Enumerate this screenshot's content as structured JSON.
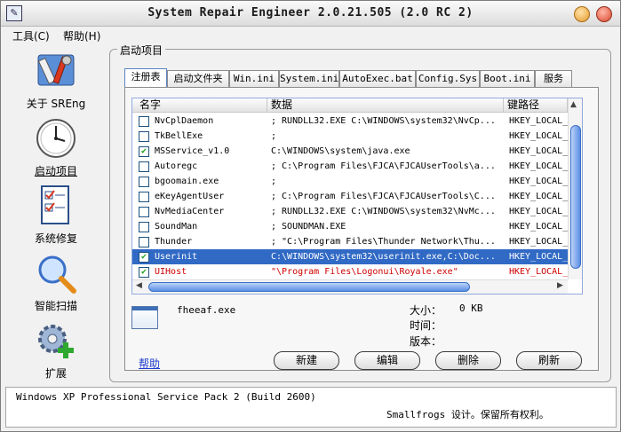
{
  "window": {
    "title": "System Repair Engineer 2.0.21.505 (2.0 RC 2)"
  },
  "menu": [
    "工具(C)",
    "帮助(H)"
  ],
  "nav": [
    {
      "label": "关于 SREng",
      "icon": "tools-icon"
    },
    {
      "label": "启动项目",
      "icon": "clock-icon",
      "selected": true
    },
    {
      "label": "系统修复",
      "icon": "checklist-icon"
    },
    {
      "label": "智能扫描",
      "icon": "magnifier-icon"
    },
    {
      "label": "扩展",
      "icon": "gear-plus-icon"
    }
  ],
  "group_title": "启动项目",
  "tabs": [
    "注册表",
    "启动文件夹",
    "Win.ini",
    "System.ini",
    "AutoExec.bat",
    "Config.Sys",
    "Boot.ini",
    "服务"
  ],
  "list": {
    "headers": [
      "名字",
      "数据",
      "键路径"
    ],
    "rows": [
      {
        "checked": false,
        "name": "NvCplDaemon",
        "data": "; RUNDLL32.EXE C:\\WINDOWS\\system32\\NvCp...",
        "key": "HKEY_LOCAL_M"
      },
      {
        "checked": false,
        "name": "TkBellExe",
        "data": ";",
        "key": "HKEY_LOCAL_M"
      },
      {
        "checked": true,
        "name": "MSService_v1.0",
        "data": "C:\\WINDOWS\\system\\java.exe",
        "key": "HKEY_LOCAL_M"
      },
      {
        "checked": false,
        "name": "Autoregc",
        "data": "; C:\\Program Files\\FJCA\\FJCAUserTools\\a...",
        "key": "HKEY_LOCAL_M"
      },
      {
        "checked": false,
        "name": "bgoomain.exe",
        "data": ";",
        "key": "HKEY_LOCAL_M"
      },
      {
        "checked": false,
        "name": "eKeyAgentUser",
        "data": "; C:\\Program Files\\FJCA\\FJCAUserTools\\C...",
        "key": "HKEY_LOCAL_M"
      },
      {
        "checked": false,
        "name": "NvMediaCenter",
        "data": "; RUNDLL32.EXE C:\\WINDOWS\\system32\\NvMc...",
        "key": "HKEY_LOCAL_M"
      },
      {
        "checked": false,
        "name": "SoundMan",
        "data": "; SOUNDMAN.EXE",
        "key": "HKEY_LOCAL_M"
      },
      {
        "checked": false,
        "name": "Thunder",
        "data": "; \"C:\\Program Files\\Thunder Network\\Thu...",
        "key": "HKEY_LOCAL_M"
      },
      {
        "checked": true,
        "name": "Userinit",
        "data": "C:\\WINDOWS\\system32\\userinit.exe,C:\\Doc...",
        "key": "HKEY_LOCAL_M",
        "selected": true
      },
      {
        "checked": true,
        "name": "UIHost",
        "data": "\"\\Program Files\\Logonui\\Royale.exe\"",
        "key": "HKEY_LOCAL_M",
        "red": true
      }
    ]
  },
  "details": {
    "filename": "fheeaf.exe",
    "size_label": "大小：",
    "size_value": "0 KB",
    "time_label": "时间：",
    "version_label": "版本："
  },
  "help_link": "帮助",
  "buttons": [
    "新建",
    "编辑",
    "删除",
    "刷新"
  ],
  "status": {
    "os": "Windows XP Professional Service Pack 2 (Build 2600)",
    "copyright": "Smallfrogs 设计。保留所有权利。"
  }
}
